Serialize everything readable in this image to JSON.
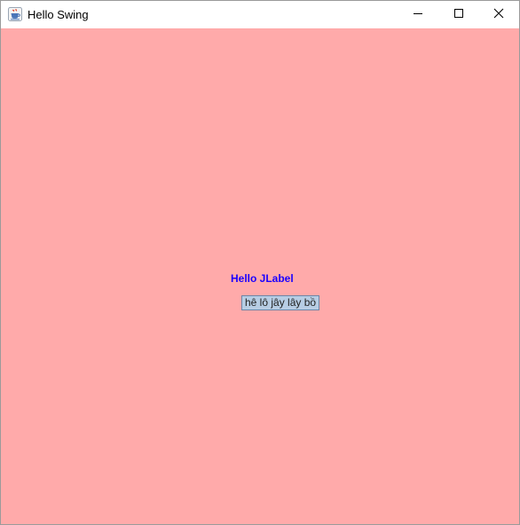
{
  "window": {
    "title": "Hello Swing",
    "icon": "java-cup-icon",
    "controls": {
      "minimize_icon": "minimize-icon",
      "maximize_icon": "maximize-icon",
      "close_icon": "close-icon"
    }
  },
  "content": {
    "background_color": "#ffaaaa",
    "label": {
      "text": "Hello JLabel",
      "color": "#1a00ff"
    },
    "button": {
      "text": "hê lô jây lây bồ",
      "background_color": "#b7cde4"
    }
  }
}
